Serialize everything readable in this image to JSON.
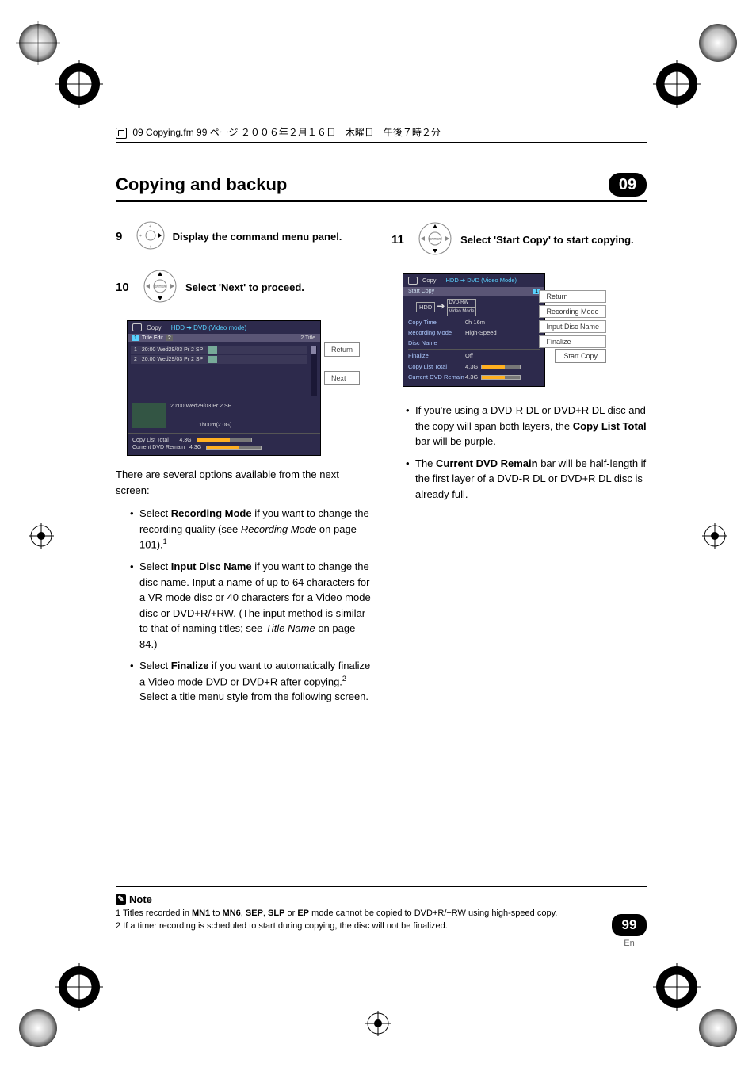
{
  "running_head": "09 Copying.fm  99 ページ  ２００６年２月１６日　木曜日　午後７時２分",
  "header": {
    "title": "Copying and backup",
    "chapter": "09"
  },
  "left_col": {
    "step9": {
      "num": "9",
      "text": "Display the command menu panel."
    },
    "step10": {
      "num": "10",
      "text": "Select 'Next' to proceed."
    },
    "screenshot1": {
      "top_label": "Copy",
      "top_sub": "HDD ➔ DVD (Video mode)",
      "tab_left_num": "2",
      "tab_left": "Title Edit",
      "tab_right": "2  Title",
      "rows": [
        {
          "n": "1",
          "t": "20:00  Wed29/03  Pr 2   SP"
        },
        {
          "n": "2",
          "t": "20:00  Wed29/03  Pr 2   SP"
        }
      ],
      "side_return": "Return",
      "side_next": "Next",
      "preview_line1": "20:00   Wed29/03   Pr 2   SP",
      "preview_line2": "1h00m(2.0G)",
      "footer_total_label": "Copy List Total",
      "footer_total_val": "4.3G",
      "footer_remain_label": "Current DVD Remain",
      "footer_remain_val": "4.3G"
    },
    "after_ss_text": "There are several options available from the next screen:",
    "bullets": [
      {
        "pre": "Select ",
        "bold": "Recording Mode",
        "post": " if you want to change the recording quality (see ",
        "ital": "Recording Mode",
        "post2": " on page 101).",
        "sup": "1"
      },
      {
        "pre": "Select ",
        "bold": "Input Disc Name",
        "post": " if you want to change the disc name. Input a name of up to 64 characters for a VR mode disc or 40 characters for a Video mode disc or DVD+R/+RW. (The input method is similar to that of naming titles; see ",
        "ital": "Title Name",
        "post2": " on page 84.)"
      },
      {
        "pre": "Select ",
        "bold": "Finalize",
        "post": " if you want to automatically finalize a Video mode DVD or DVD+R after copying.",
        "sup": "2",
        "post2": " Select a title menu style from the following screen."
      }
    ]
  },
  "right_col": {
    "step11": {
      "num": "11",
      "text_bold": "Select 'Start Copy' to start copying."
    },
    "screenshot2": {
      "top_label": "Copy",
      "top_sub": "HDD ➔ DVD (Video Mode)",
      "tab": "Start Copy",
      "tab_right": "1",
      "hdd": "HDD",
      "arrow": "➔",
      "dvd1": "DVD-RW",
      "dvd2": "Video Mode",
      "lines": [
        {
          "label": "Copy Time",
          "val": "0h 16m"
        },
        {
          "label": "Recording Mode",
          "val": "High-Speed"
        },
        {
          "label": "Disc Name",
          "val": ""
        },
        {
          "label": "Finalize",
          "val": "Off"
        },
        {
          "label": "Copy List Total",
          "val": "4.3G"
        },
        {
          "label": "Current DVD Remain",
          "val": "4.3G"
        }
      ],
      "side_opts": [
        "Return",
        "Recording Mode",
        "Input Disc Name",
        "Finalize"
      ],
      "start": "Start Copy"
    },
    "bullets": [
      {
        "text1": "If you're using a DVD-R DL or DVD+R DL disc and the copy will span both layers, the ",
        "bold": "Copy List Total",
        "text2": " bar will be purple."
      },
      {
        "text1": "The ",
        "bold": "Current DVD Remain",
        "text2": " bar will be half-length if the first layer of a DVD-R DL or DVD+R DL disc is already full."
      }
    ]
  },
  "notes": {
    "label": "Note",
    "items": [
      {
        "n": "1",
        "t": " Titles recorded in ",
        "b1": "MN1",
        "t2": " to ",
        "b2": "MN6",
        "t3": ", ",
        "b3": "SEP",
        "t4": ", ",
        "b4": "SLP",
        "t5": " or ",
        "b5": "EP",
        "t6": " mode cannot be copied to DVD+R/+RW using high-speed copy."
      },
      {
        "n": "2",
        "t": " If a timer recording is scheduled to start during copying, the disc will not be finalized."
      }
    ]
  },
  "page": {
    "num": "99",
    "lang": "En"
  },
  "icons": {
    "enter": "ENTER"
  }
}
